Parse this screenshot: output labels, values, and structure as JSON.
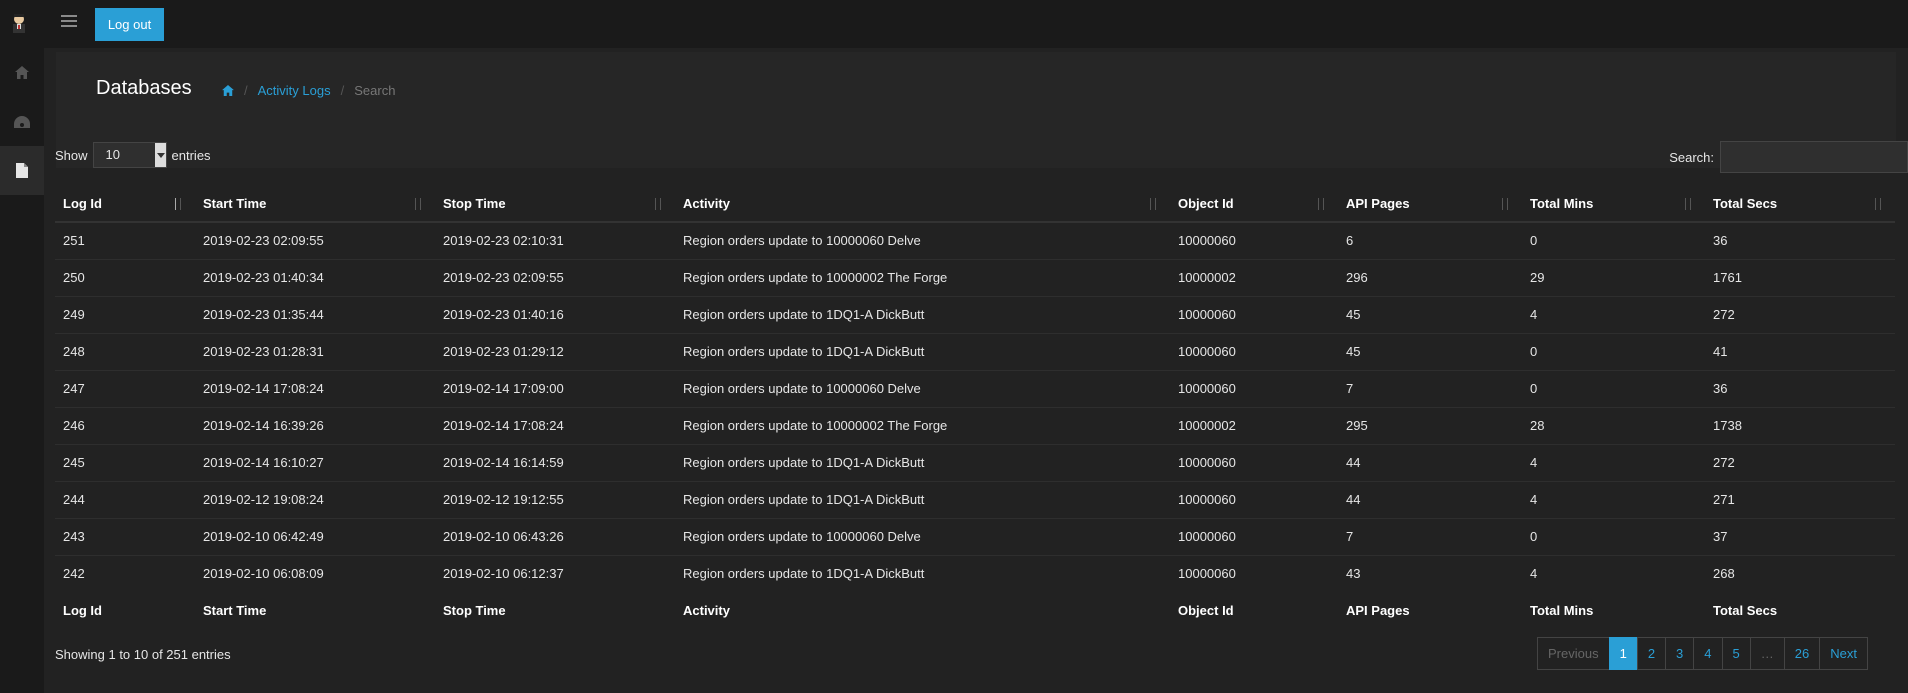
{
  "header": {
    "logout_label": "Log out"
  },
  "sidebar": {
    "items": [
      {
        "icon": "home-icon"
      },
      {
        "icon": "dashboard-icon"
      },
      {
        "icon": "file-icon"
      }
    ]
  },
  "page": {
    "title": "Databases",
    "breadcrumb": {
      "link": "Activity Logs",
      "current": "Search"
    }
  },
  "table_controls": {
    "show_label": "Show",
    "entries_value": "10",
    "entries_label": "entries",
    "search_label": "Search:",
    "search_value": ""
  },
  "table": {
    "columns": [
      "Log Id",
      "Start Time",
      "Stop Time",
      "Activity",
      "Object Id",
      "API Pages",
      "Total Mins",
      "Total Secs"
    ],
    "rows": [
      [
        "251",
        "2019-02-23 02:09:55",
        "2019-02-23 02:10:31",
        "Region orders update to 10000060 Delve",
        "10000060",
        "6",
        "0",
        "36"
      ],
      [
        "250",
        "2019-02-23 01:40:34",
        "2019-02-23 02:09:55",
        "Region orders update to 10000002 The Forge",
        "10000002",
        "296",
        "29",
        "1761"
      ],
      [
        "249",
        "2019-02-23 01:35:44",
        "2019-02-23 01:40:16",
        "Region orders update to 1DQ1-A DickButt",
        "10000060",
        "45",
        "4",
        "272"
      ],
      [
        "248",
        "2019-02-23 01:28:31",
        "2019-02-23 01:29:12",
        "Region orders update to 1DQ1-A DickButt",
        "10000060",
        "45",
        "0",
        "41"
      ],
      [
        "247",
        "2019-02-14 17:08:24",
        "2019-02-14 17:09:00",
        "Region orders update to 10000060 Delve",
        "10000060",
        "7",
        "0",
        "36"
      ],
      [
        "246",
        "2019-02-14 16:39:26",
        "2019-02-14 17:08:24",
        "Region orders update to 10000002 The Forge",
        "10000002",
        "295",
        "28",
        "1738"
      ],
      [
        "245",
        "2019-02-14 16:10:27",
        "2019-02-14 16:14:59",
        "Region orders update to 1DQ1-A DickButt",
        "10000060",
        "44",
        "4",
        "272"
      ],
      [
        "244",
        "2019-02-12 19:08:24",
        "2019-02-12 19:12:55",
        "Region orders update to 1DQ1-A DickButt",
        "10000060",
        "44",
        "4",
        "271"
      ],
      [
        "243",
        "2019-02-10 06:42:49",
        "2019-02-10 06:43:26",
        "Region orders update to 10000060 Delve",
        "10000060",
        "7",
        "0",
        "37"
      ],
      [
        "242",
        "2019-02-10 06:08:09",
        "2019-02-10 06:12:37",
        "Region orders update to 1DQ1-A DickButt",
        "10000060",
        "43",
        "4",
        "268"
      ]
    ]
  },
  "footer": {
    "info": "Showing 1 to 10 of 251 entries",
    "pagination": [
      "Previous",
      "1",
      "2",
      "3",
      "4",
      "5",
      "…",
      "26",
      "Next"
    ],
    "active_page": "1"
  },
  "colors": {
    "accent": "#2a9fd6",
    "background": "#222222",
    "topbar": "#1a1a1a"
  }
}
